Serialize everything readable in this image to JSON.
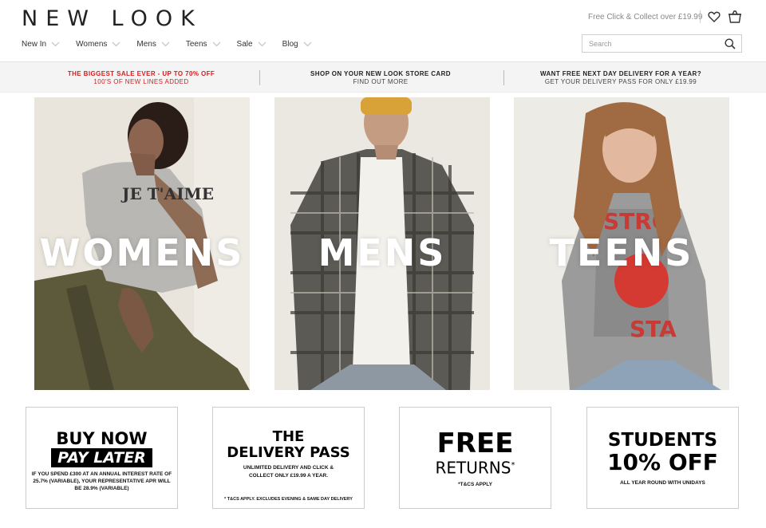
{
  "header": {
    "logo": "NEW LOOK",
    "click_collect": "Free Click & Collect over £19.99",
    "search_placeholder": "Search"
  },
  "nav": [
    "New In",
    "Womens",
    "Mens",
    "Teens",
    "Sale",
    "Blog"
  ],
  "promos": [
    {
      "line1": "THE BIGGEST SALE EVER - UP TO 70% OFF",
      "line2": "100'S OF NEW LINES ADDED"
    },
    {
      "line1": "SHOP ON YOUR NEW LOOK STORE CARD",
      "line2": "FIND OUT MORE"
    },
    {
      "line1": "WANT FREE NEXT DAY DELIVERY FOR A YEAR?",
      "line2": "GET YOUR DELIVERY PASS FOR ONLY £19.99"
    }
  ],
  "tiles": [
    "WOMENS",
    "MENS",
    "TEENS"
  ],
  "cards": {
    "buy_now": {
      "line1": "BUY NOW",
      "line2": "PAY LATER",
      "text": "IF YOU SPEND £300 AT AN ANNUAL INTEREST RATE OF 25.7% (VARIABLE), YOUR REPRESENTATIVE APR WILL BE 28.9% (VARIABLE)"
    },
    "delivery": {
      "line1": "THE",
      "line2": "DELIVERY PASS",
      "text": "UNLIMITED DELIVERY AND CLICK & COLLECT ONLY £19.99 A YEAR.",
      "footnote": "* T&CS APPLY. EXCLUDES EVENING & SAME DAY DELIVERY"
    },
    "returns": {
      "line1": "FREE",
      "line2": "RETURNS",
      "mark": "*",
      "text": "*T&CS APPLY"
    },
    "students": {
      "line1": "STUDENTS",
      "line2": "10% OFF",
      "text": "ALL YEAR ROUND WITH UNIDAYS"
    }
  },
  "colors": {
    "accent_red": "#d21e1e",
    "strip_bg": "#f4f4f4"
  },
  "icons": [
    "heart-icon",
    "bag-icon",
    "search-icon",
    "chevron-down-icon"
  ]
}
